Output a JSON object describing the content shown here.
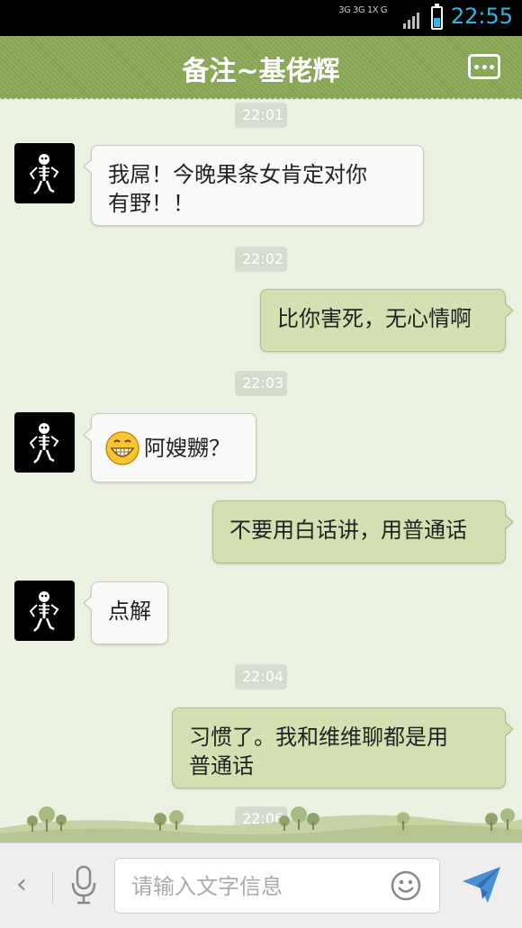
{
  "status_bar": {
    "network_type_1": "3G",
    "network_type_2": "3G",
    "network_type_3": "1X",
    "network_type_4": "G",
    "time": "22:55"
  },
  "header": {
    "title": "备注~基佬辉",
    "menu_icon": "more-icon"
  },
  "messages": [
    {
      "type": "timestamp",
      "text": "22:01"
    },
    {
      "type": "message",
      "side": "left",
      "text": "我屌！今晚果条女肯定对你\n有野！！"
    },
    {
      "type": "timestamp",
      "text": "22:02"
    },
    {
      "type": "message",
      "side": "right",
      "text": "比你害死，无心情啊"
    },
    {
      "type": "timestamp",
      "text": "22:03"
    },
    {
      "type": "message",
      "side": "left",
      "emoji": "grin-emoji",
      "text": "阿嫂嬲？"
    },
    {
      "type": "message",
      "side": "right",
      "text": "不要用白话讲，用普通话"
    },
    {
      "type": "message",
      "side": "left",
      "text": "点解"
    },
    {
      "type": "timestamp",
      "text": "22:04"
    },
    {
      "type": "message",
      "side": "right",
      "text": "习惯了。我和维维聊都是用\n普通话"
    },
    {
      "type": "timestamp",
      "text": "22:06"
    }
  ],
  "input_bar": {
    "placeholder": "请输入文字信息",
    "value": ""
  },
  "colors": {
    "header_bg": "#8aa858",
    "chat_bg": "#eaf1e0",
    "bubble_left": "#f9f9f7",
    "bubble_right": "#d3e0b0",
    "clock": "#33b5e5",
    "send_icon": "#4a8fd4"
  }
}
